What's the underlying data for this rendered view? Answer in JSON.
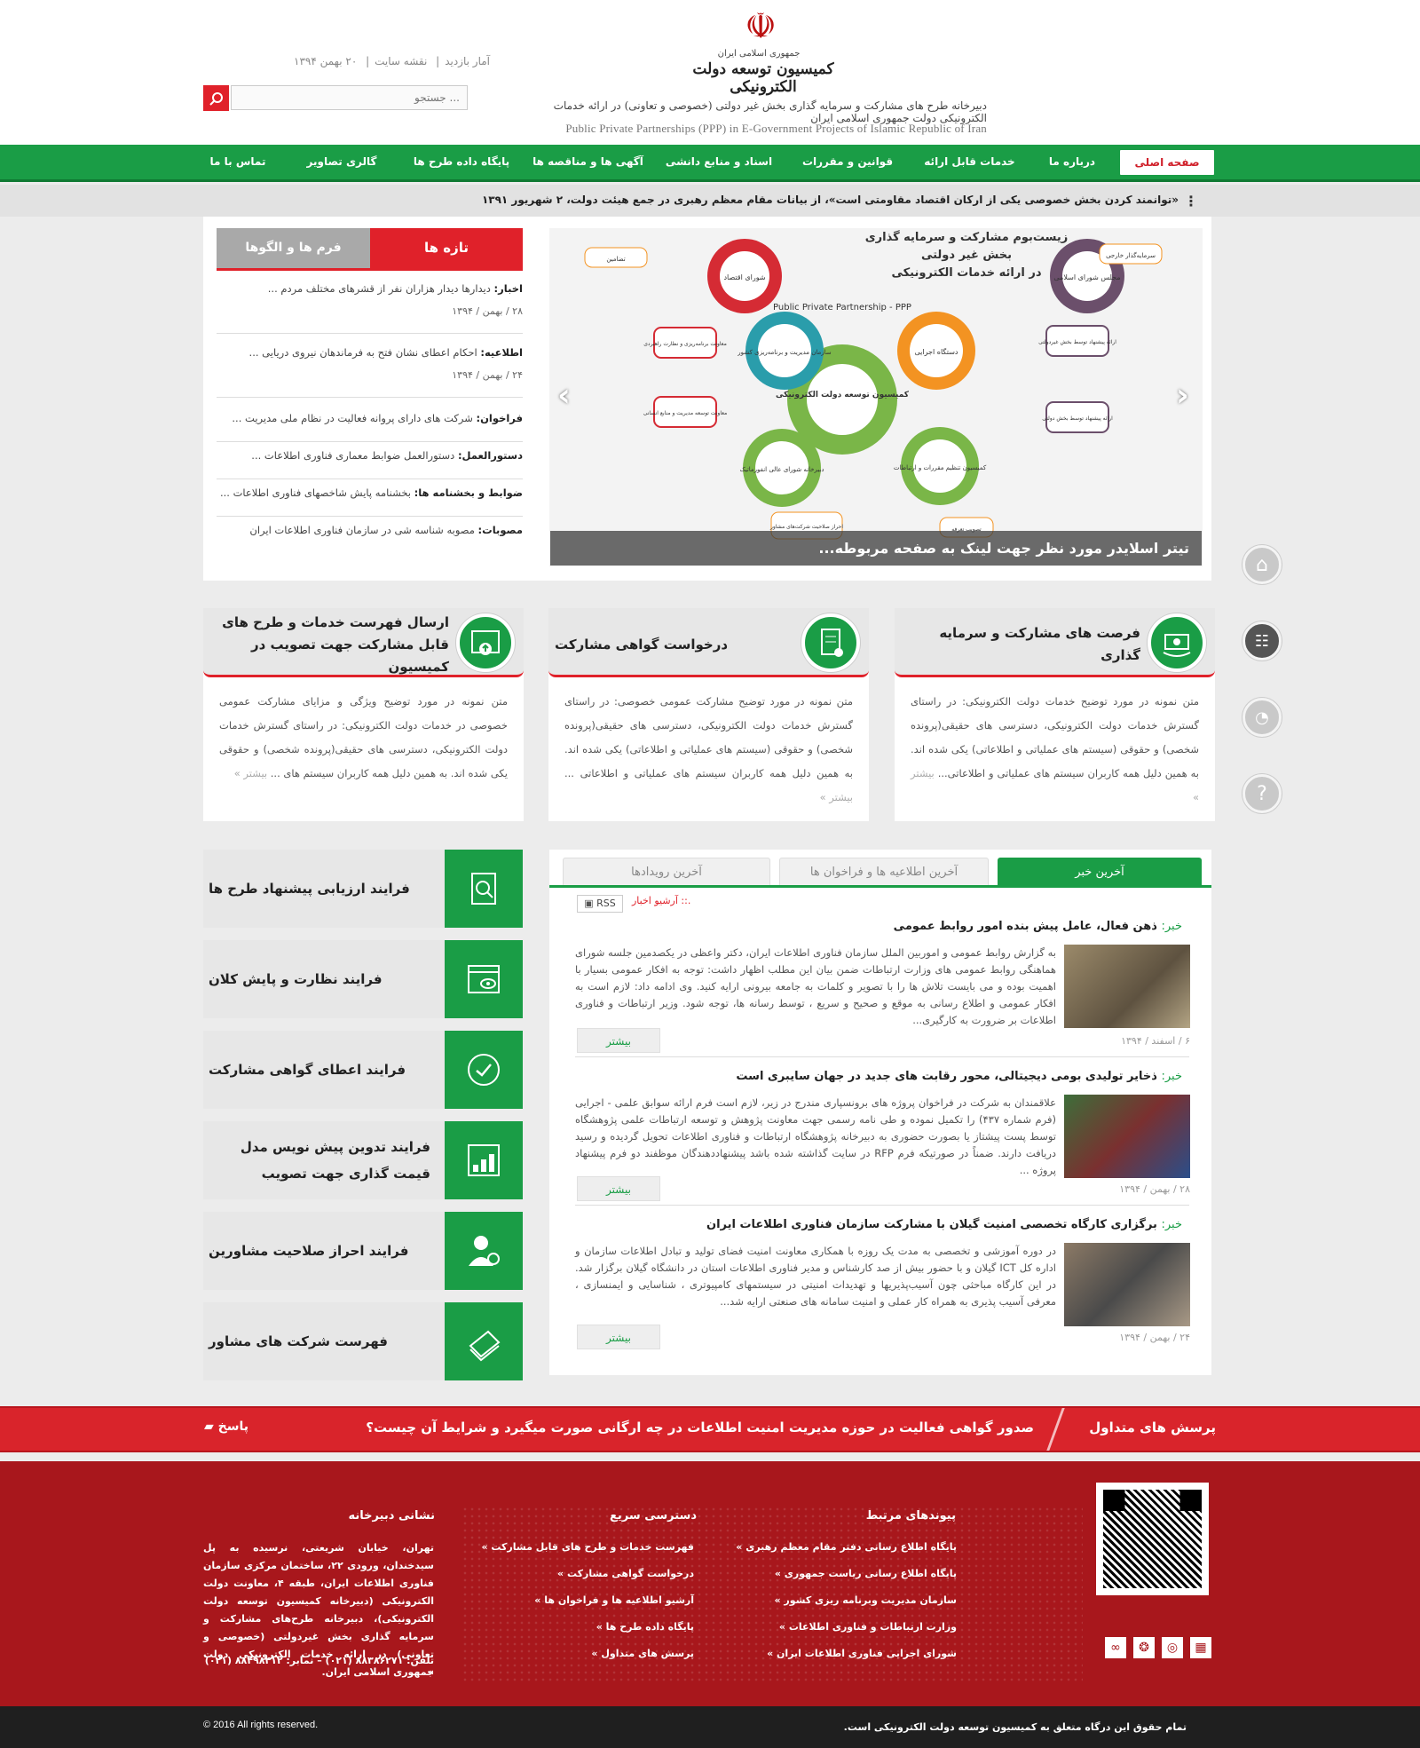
{
  "header": {
    "emblem": "☫",
    "logo_small": "جمهوری اسلامی ایران",
    "logo_main": "کمیسیون توسعه دولت الکترونیکی",
    "logo_fa": "دبیرخانه طرح های مشارکت و سرمایه گذاری بخش غیر دولتی (خصوصی و تعاونی) در ارائه خدمات الکترونیکی دولت جمهوری اسلامی ایران",
    "logo_en": "Public Private Partnerships (PPP) in E-Government Projects of Islamic Republic of Iran",
    "toplinks": [
      "آمار بازدید",
      "نقشه سایت",
      "۲۰ بهمن ۱۳۹۴"
    ],
    "search_placeholder": "جستجو ..."
  },
  "nav": [
    "صفحه اصلی",
    "درباره ما",
    "خدمات قابل ارائه",
    "قوانین و مقررات",
    "اسناد و منابع دانشی",
    "آگهی ها و مناقصه ها",
    "پایگاه داده طرح ها",
    "گالری تصاویر",
    "تماس با ما"
  ],
  "ticker": "«توانمند کردن بخش خصوصی یکی از ارکان اقتصاد مقاومتی است»، از بیانات مقام معظم رهبری در جمع هیئت دولت، ۲ شهریور ۱۳۹۱",
  "slider": {
    "caption": "تیتر اسلایدر مورد نظر جهت لینک به صفحه مربوطه...",
    "diagram_title": [
      "زیست‌بوم مشارکت و سرمایه گذاری",
      "بخش غیر دولتی",
      "در ارائه خدمات الکترونیکی"
    ],
    "diagram_subtitle": "Public Private Partnership - PPP",
    "center": "کمیسیون توسعه دولت الکترونیکی",
    "nodes": [
      "مجلس شورای اسلامی",
      "شورای اقتصاد",
      "سازمان مدیریت و برنامه‌ریزی کشور",
      "دستگاه اجرایی",
      "دبیرخانه شورای عالی انفورماتیک",
      "کمیسیون تنظیم مقررات و ارتباطات"
    ],
    "boxes": [
      "سرمایه‌گذار خارجی",
      "تضامین",
      "معاونت برنامه‌ریزی و نظارت راهبردی",
      "ارائه پیشنهاد توسط بخش غیردولتی",
      "معاونت توسعه مدیریت و منابع انسانی",
      "ارائه پیشنهاد توسط بخش دولتی",
      "احراز صلاحیت شرکت‌های مشاور",
      "تصویب تعرفه"
    ]
  },
  "tabs_box": {
    "tab_news": "تازه ها",
    "tab_forms": "فرم ها و الگوها",
    "items": [
      {
        "label": "اخبار:",
        "text": "دیدارها دیدار هزاران نفر از قشرهای مختلف مردم ...",
        "date": "۲۸ / بهمن / ۱۳۹۴"
      },
      {
        "label": "اطلاعیه:",
        "text": "احکام اعطای نشان فتح به فرماندهان نیروی دریایی ...",
        "date": "۲۴ / بهمن / ۱۳۹۴"
      },
      {
        "label": "فراخوان:",
        "text": "شرکت های دارای پروانه فعالیت در نظام ملی مدیریت ...",
        "date": ""
      },
      {
        "label": "دستورالعمل:",
        "text": "دستورالعمل ضوابط معماری فناوری اطلاعات ...",
        "date": ""
      },
      {
        "label": "ضوابط و بخشنامه ها:",
        "text": "بخشنامه پایش شاخصهای فناوری اطلاعات ...",
        "date": ""
      },
      {
        "label": "مصوبات:",
        "text": "مصوبه شناسه شی در سازمان فناوری اطلاعات ایران",
        "date": ""
      }
    ]
  },
  "features": [
    {
      "title": "فرصت های مشارکت و سرمایه گذاری",
      "body": "متن نمونه در مورد توضیح خدمات دولت الکترونیکی: در راستای گسترش خدمات دولت الکترونیکی، دسترسی های حقیقی(پرونده شخصی) و حقوقی (سیستم های عملیاتی و اطلاعاتی) یکی شده اند. به همین دلیل همه کاربران سیستم های عملیاتی و اطلاعاتی...",
      "more": "بیشتر »"
    },
    {
      "title": "درخواست گواهی مشارکت",
      "body": "متن نمونه در مورد توضیح مشارکت عمومی خصوصی: در راستای گسترش خدمات دولت الکترونیکی، دسترسی های حقیقی(پرونده شخصی) و حقوقی (سیستم های عملیاتی و اطلاعاتی) یکی شده اند. به همین دلیل همه کاربران سیستم های عملیاتی و اطلاعاتی ...",
      "more": "بیشتر »"
    },
    {
      "title": "ارسال فهرست خدمات و طرح های قابل مشارکت جهت تصویب در کمیسیون",
      "body": "متن نمونه در مورد توضیح ویژگی و مزایای مشارکت عمومی خصوصی در خدمات دولت الکترونیکی: در راستای گسترش خدمات دولت الکترونیکی، دسترسی های حقیقی(پرونده شخصی) و حقوقی یکی شده اند. به همین دلیل همه کاربران سیستم های ...",
      "more": "بیشتر »"
    }
  ],
  "processes": [
    "فرایند ارزیابی پیشنهاد طرح ها",
    "فرایند نظارت و پایش کلان",
    "فرایند اعطای گواهی مشارکت",
    "فرایند تدوین پیش نویس مدل قیمت گذاری جهت تصویب",
    "فرایند احراز صلاحیت مشاورین",
    "فهرست شرکت های مشاور"
  ],
  "news_box": {
    "tabs": [
      "آخرین خبر",
      "آخرین اطلاعیه ها و فراخوان ها",
      "آخرین رویدادها"
    ],
    "archive": ".:: آرشیو اخبار",
    "rss": "RSS",
    "items": [
      {
        "label": "خبر:",
        "title": "ذهن فعال، عامل پیش بنده امور روابط عمومی",
        "body": "به گزارش روابط عمومی و اموربین الملل سازمان فناوری اطلاعات ایران، دکتر واعظی در یکصدمین جلسه شورای هماهنگی روابط عمومی های وزارت ارتباطات ضمن بیان این مطلب اظهار داشت: توجه به افکار عمومی بسیار با اهمیت بوده و می بایست تلاش ها را با تصویر و کلمات به جامعه بیرونی ارایه کنید. وی ادامه داد: لازم است به افکار عمومی و اطلاع رسانی به موقع و صحیح و سریع ، توسط رسانه ها، توجه شود. وزیر ارتباطات و فناوری اطلاعات بر ضرورت به کارگیری...",
        "more": "بیشتر",
        "date": "۶ / اسفند / ۱۳۹۴"
      },
      {
        "label": "خبر:",
        "title": "ذخایر تولیدی بومی دیجیتالی، محور رقابت های جدید در جهان سایبری است",
        "body": "علاقمندان به شرکت در فراخوان پروژه های برونسپاری مندرج در زیر، لازم است فرم ارائه سوابق علمی - اجرایی (فرم شماره ۴۳۷) را تکمیل نموده و طی نامه رسمی جهت معاونت پژوهش و توسعه ارتباطات علمی پژوهشگاه توسط پست پیشتاز یا بصورت حضوری به دبیرخانه پژوهشگاه ارتباطات و فناوری اطلاعات تحویل گردیده و رسید دریافت دارند. ضمناً در صورتیکه فرم RFP در سایت گذاشته شده باشد پیشنهاددهندگان موظفند دو فرم پیشنهاد پروژه ...",
        "more": "بیشتر",
        "date": "۲۸ / بهمن / ۱۳۹۴"
      },
      {
        "label": "خبر:",
        "title": "برگزاری کارگاه تخصصی امنیت گیلان با مشارکت سازمان فناوری اطلاعات ایران",
        "body": "در دوره آموزشی و تخصصی به مدت یک روزه با همکاری معاونت امنیت فضای تولید و تبادل اطلاعات سازمان و اداره کل ICT گیلان و با حضور بیش از صد کارشناس و مدیر فناوری اطلاعات استان در دانشگاه گیلان برگزار شد. در این کارگاه مباحثی چون آسیب‌پذیریها و تهدیدات امنیتی در سیستمهای کامپیوتری ، شناسایی و ایمنسازی ، معرفی آسیب پذیری به همراه کار عملی و امنیت سامانه های صنعتی ارایه شد...",
        "more": "بیشتر",
        "date": "۲۴ / بهمن / ۱۳۹۴"
      }
    ]
  },
  "faq": {
    "title": "پرسش های متداول",
    "question": "صدور گواهی فعالیت در حوزه مدیریت امنیت اطلاعات در چه ارگانی صورت میگیرد و شرایط آن چیست؟",
    "answer": "پاسخ"
  },
  "footer": {
    "related_title": "پیوندهای مرتبط",
    "related": [
      "پایگاه اطلاع رسانی دفتر مقام معظم رهبری",
      "پایگاه اطلاع رسانی ریاست جمهوری",
      "سازمان مدیریت وبرنامه ریزی کشور",
      "وزارت ارتباطات و فناوری اطلاعات",
      "شورای اجرایی فناوری اطلاعات ایران"
    ],
    "quick_title": "دسترسی سریع",
    "quick": [
      "فهرست خدمات و طرح های قابل مشارکت",
      "درخواست گواهی مشارکت",
      "آرشیو اطلاعیه ها و فراخوان ها",
      "پایگاه داده طرح ها",
      "پرسش های متداول"
    ],
    "address_title": "نشانی دبیرخانه",
    "address": "تهران، خیابان شریعتی، نرسیده به پل سیدخندان، ورودی ۲۲، ساختمان مرکزی سازمان فناوری اطلاعات ایران، طبقه ۴، معاونت دولت الکترونیکی (دبیرخانه کمیسیون توسعه دولت الکترونیکی)، دبیرخانه طرح‌های مشارکت و سرمایه گذاری بخش غیردولتی (خصوصی و تعاونی) در ارائه خدمات الکترونیکی دولت جمهوری اسلامی ایران.",
    "phone": "تلفن: ۸۸۳۸۶۲۷۱ (۰۲۱) – نمابر: ۸۸۴۹۸۴۱۲ (۰۲۱)"
  },
  "bottom": {
    "rights_fa": "تمام حقوق این درگاه متعلق به کمیسیون توسعه دولت الکترونیکی است.",
    "rights_en": "© 2016 All rights reserved."
  },
  "colors": {
    "green": "#1a9d46",
    "red": "#e0212a",
    "footer_red": "#a8171c"
  }
}
